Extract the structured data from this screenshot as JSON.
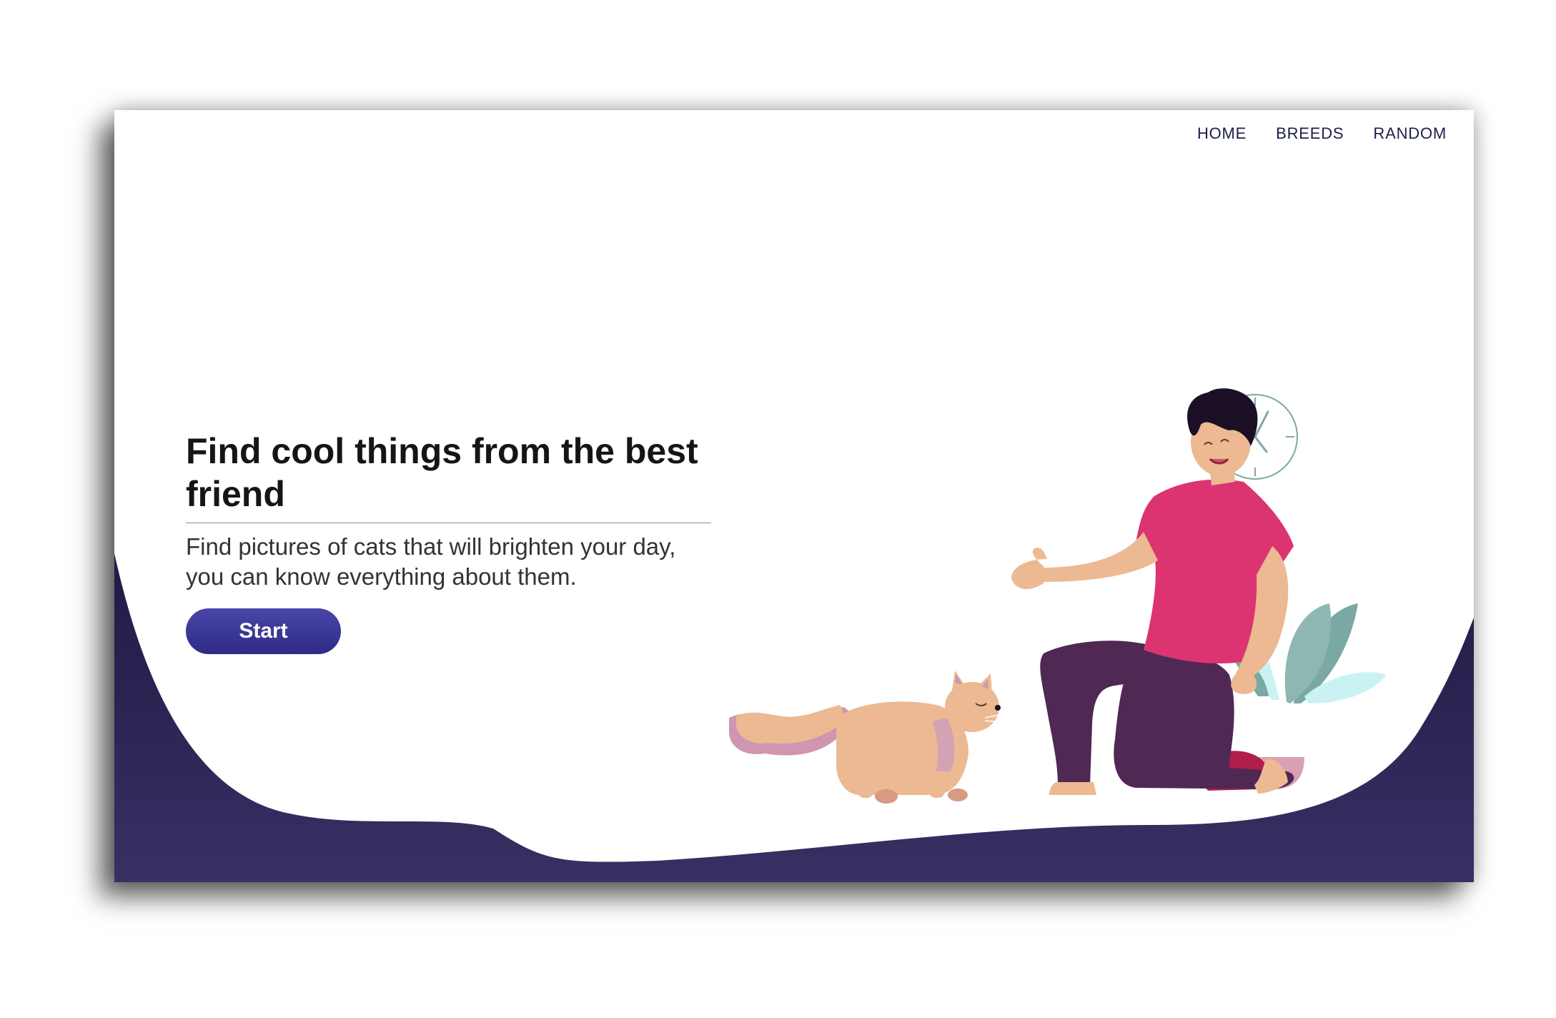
{
  "nav": {
    "items": [
      {
        "label": "HOME"
      },
      {
        "label": "BREEDS"
      },
      {
        "label": "RANDOM"
      }
    ]
  },
  "hero": {
    "title": "Find cool things from the best friend",
    "subtitle": "Find pictures of cats that will brighten your day, you can know everything about them.",
    "cta_label": "Start"
  },
  "colors": {
    "wave_top": "#1f1b45",
    "wave_bottom": "#3a2f64",
    "nav_text": "#1c1f4a",
    "button": "#3b379a",
    "shirt": "#dc3470",
    "pants": "#4f2854",
    "skin": "#ecb992",
    "plant_dark": "#7aa8a2",
    "plant_light": "#cbf2f2"
  },
  "icons": [
    "clock-icon",
    "man-figure",
    "cat-figure",
    "plant-figure"
  ]
}
